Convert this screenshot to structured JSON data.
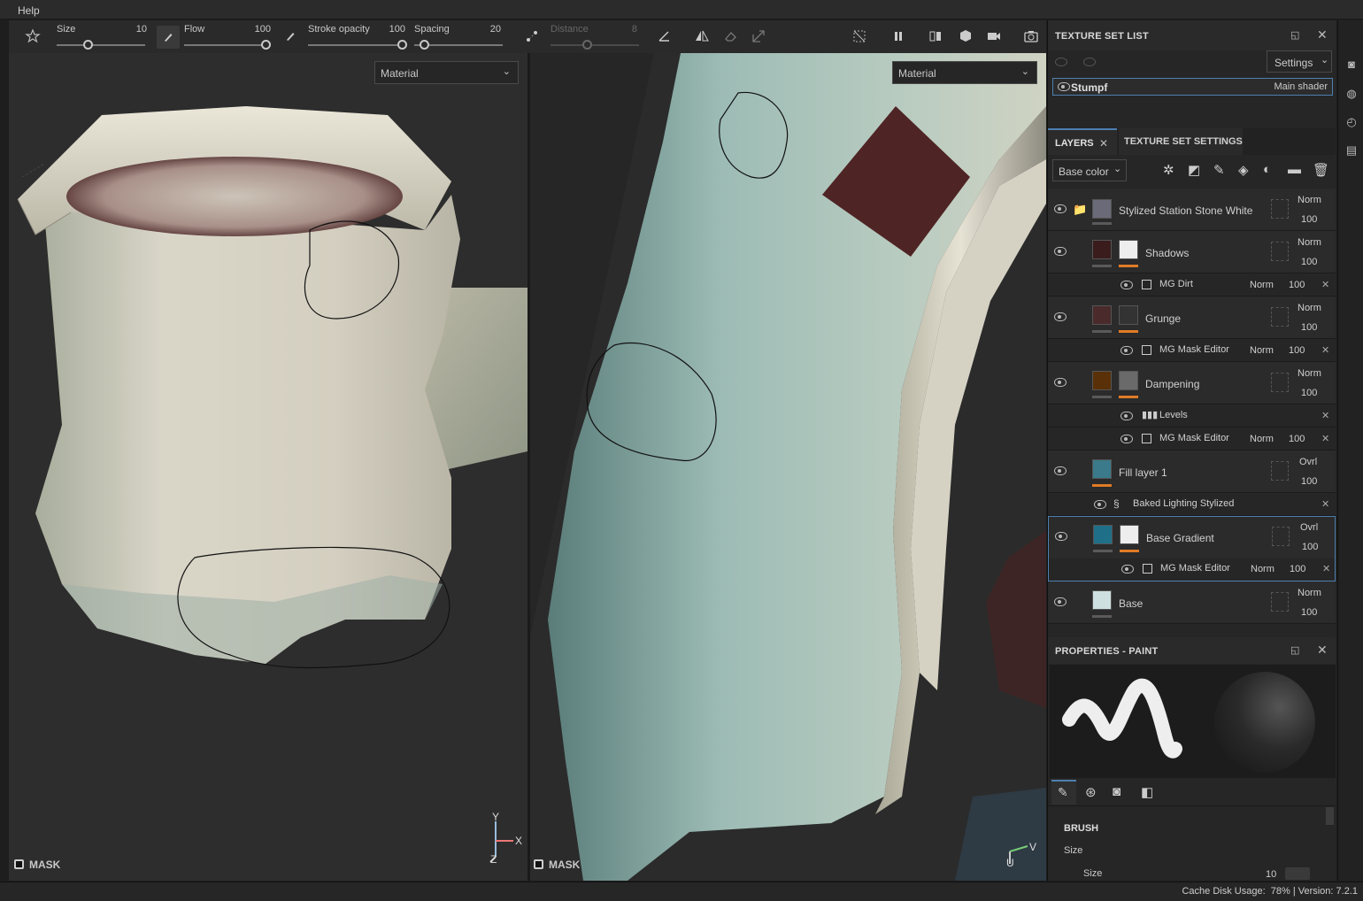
{
  "menubar": {
    "help": "Help"
  },
  "toolbar": {
    "size_label": "Size",
    "size_value": "10",
    "flow_label": "Flow",
    "flow_value": "100",
    "stroke_opacity_label": "Stroke opacity",
    "stroke_opacity_value": "100",
    "spacing_label": "Spacing",
    "spacing_value": "20",
    "distance_label": "Distance",
    "distance_value": "8"
  },
  "viewport_left": {
    "material_dropdown": "Material",
    "mask_label": "MASK",
    "axis_y": "Y",
    "axis_x": "X",
    "axis_z": "Z"
  },
  "viewport_right": {
    "material_dropdown": "Material",
    "mask_label": "MASK",
    "axis_u": "U",
    "axis_v": "V"
  },
  "texture_set_list": {
    "title": "TEXTURE SET LIST",
    "settings_label": "Settings",
    "set_name": "Stumpf",
    "shader": "Main shader"
  },
  "layers_panel": {
    "tab_layers": "LAYERS",
    "tab_texture_set_settings": "TEXTURE SET SETTINGS",
    "channel_dropdown": "Base color",
    "layers": [
      {
        "name": "Stylized Station Stone White",
        "blend": "Norm",
        "opacity": "100",
        "color": "#6a6a78"
      },
      {
        "name": "Shadows",
        "blend": "Norm",
        "opacity": "100",
        "color": "#3a1c1c"
      },
      {
        "name": "Grunge",
        "blend": "Norm",
        "opacity": "100",
        "color": "#4a2a2a"
      },
      {
        "name": "Dampening",
        "blend": "Norm",
        "opacity": "100",
        "color": "#5a3008"
      },
      {
        "name": "Fill layer 1",
        "blend": "Ovrl",
        "opacity": "100",
        "color": "#3a7a8a"
      },
      {
        "name": "Base Gradient",
        "blend": "Ovrl",
        "opacity": "100",
        "color": "#1f6f88"
      },
      {
        "name": "Base",
        "blend": "Norm",
        "opacity": "100",
        "color": "#cfe0e0"
      }
    ],
    "effects": [
      {
        "name": "MG Dirt",
        "blend": "Norm",
        "opacity": "100"
      },
      {
        "name": "MG Mask Editor",
        "blend": "Norm",
        "opacity": "100"
      },
      {
        "name": "Levels"
      },
      {
        "name": "MG Mask Editor",
        "blend": "Norm",
        "opacity": "100"
      },
      {
        "name": "Baked Lighting Stylized"
      },
      {
        "name": "MG Mask Editor",
        "blend": "Norm",
        "opacity": "100"
      }
    ]
  },
  "properties": {
    "title": "PROPERTIES - PAINT",
    "brush_section": "BRUSH",
    "size_group": "Size",
    "size_label": "Size",
    "size_value": "10"
  },
  "status": {
    "text": "Cache Disk Usage:  78% | Version: 7.2.1"
  }
}
